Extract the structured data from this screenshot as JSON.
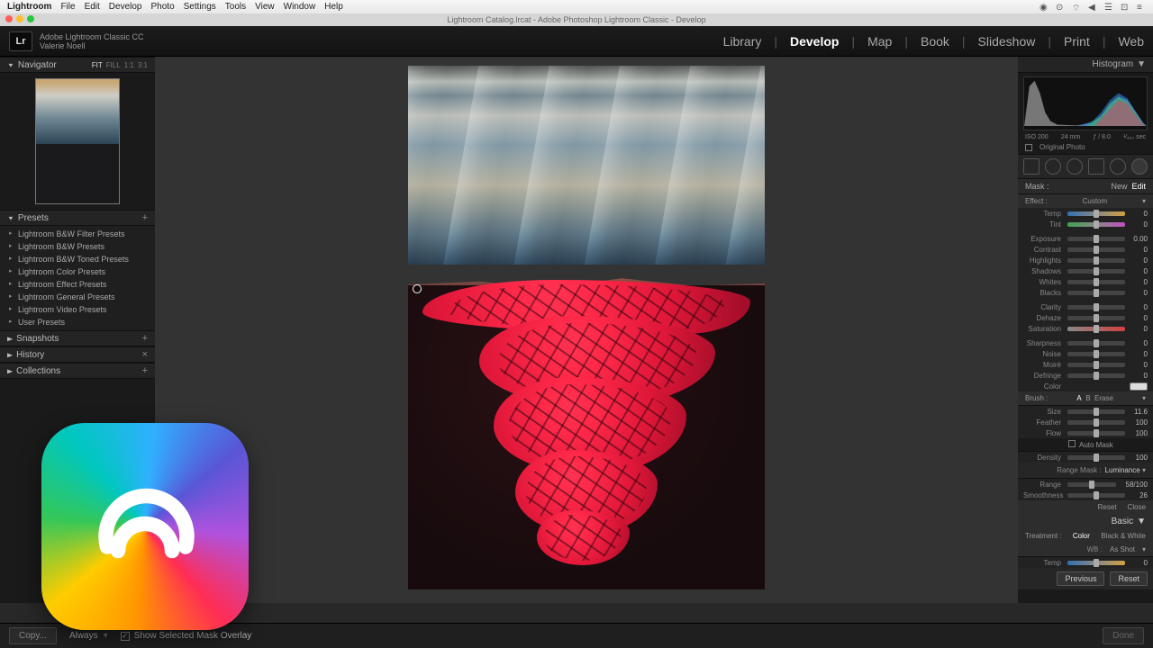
{
  "mac_menu": {
    "app": "Lightroom",
    "items": [
      "File",
      "Edit",
      "Develop",
      "Photo",
      "Settings",
      "Tools",
      "View",
      "Window",
      "Help"
    ]
  },
  "window_title": "Lightroom Catalog.lrcat - Adobe Photoshop Lightroom Classic - Develop",
  "identity": {
    "line1": "Adobe Lightroom Classic CC",
    "line2": "Valerie Noell"
  },
  "modules": [
    "Library",
    "Develop",
    "Map",
    "Book",
    "Slideshow",
    "Print",
    "Web"
  ],
  "active_module": "Develop",
  "left": {
    "navigator": {
      "title": "Navigator",
      "opts": [
        "FIT",
        "FILL",
        "1:1",
        "3:1"
      ],
      "sel": "FIT"
    },
    "presets": {
      "title": "Presets",
      "items": [
        "Lightroom B&W Filter Presets",
        "Lightroom B&W Presets",
        "Lightroom B&W Toned Presets",
        "Lightroom Color Presets",
        "Lightroom Effect Presets",
        "Lightroom General Presets",
        "Lightroom Video Presets",
        "User Presets"
      ]
    },
    "snapshots": "Snapshots",
    "history": "History",
    "collections": "Collections"
  },
  "right": {
    "histogram": "Histogram",
    "histo_meta": [
      "ISO 200",
      "24 mm",
      "ƒ / 8.0",
      "¹⁄₄₀₀ sec"
    ],
    "original": "Original Photo",
    "mask": {
      "label": "Mask :",
      "new": "New",
      "edit": "Edit"
    },
    "effect": {
      "label": "Effect :",
      "val": "Custom"
    },
    "sliders1": [
      [
        "Temp",
        "0",
        "temp"
      ],
      [
        "Tint",
        "0",
        "tint"
      ]
    ],
    "sliders2": [
      [
        "Exposure",
        "0.00",
        ""
      ],
      [
        "Contrast",
        "0",
        ""
      ],
      [
        "Highlights",
        "0",
        ""
      ],
      [
        "Shadows",
        "0",
        ""
      ],
      [
        "Whites",
        "0",
        ""
      ],
      [
        "Blacks",
        "0",
        ""
      ]
    ],
    "sliders3": [
      [
        "Clarity",
        "0",
        ""
      ],
      [
        "Dehaze",
        "0",
        ""
      ],
      [
        "Saturation",
        "0",
        "sat"
      ]
    ],
    "sliders4": [
      [
        "Sharpness",
        "0",
        ""
      ],
      [
        "Noise",
        "0",
        ""
      ],
      [
        "Moiré",
        "0",
        ""
      ],
      [
        "Defringe",
        "0",
        ""
      ]
    ],
    "color": "Color",
    "brush": {
      "label": "Brush :",
      "a": "A",
      "b": "B",
      "erase": "Erase"
    },
    "brush_sliders": [
      [
        "Size",
        "11.6"
      ],
      [
        "Feather",
        "100"
      ],
      [
        "Flow",
        "100"
      ]
    ],
    "auto_mask": "Auto Mask",
    "density": [
      "Density",
      "100"
    ],
    "range_mask": {
      "label": "Range Mask :",
      "val": "Luminance"
    },
    "range": [
      "Range",
      "58/100"
    ],
    "smooth": [
      "Smoothness",
      "26"
    ],
    "reset": "Reset",
    "close": "Close",
    "basic": "Basic",
    "treatment": {
      "label": "Treatment :",
      "c": "Color",
      "bw": "Black & White"
    },
    "wb": {
      "label": "WB :",
      "val": "As Shot"
    },
    "prev": "Previous",
    "reset2": "Reset"
  },
  "toolbar": {
    "copy": "Copy...",
    "always": "Always",
    "overlay": "Show Selected Mask Overlay",
    "done": "Done"
  }
}
